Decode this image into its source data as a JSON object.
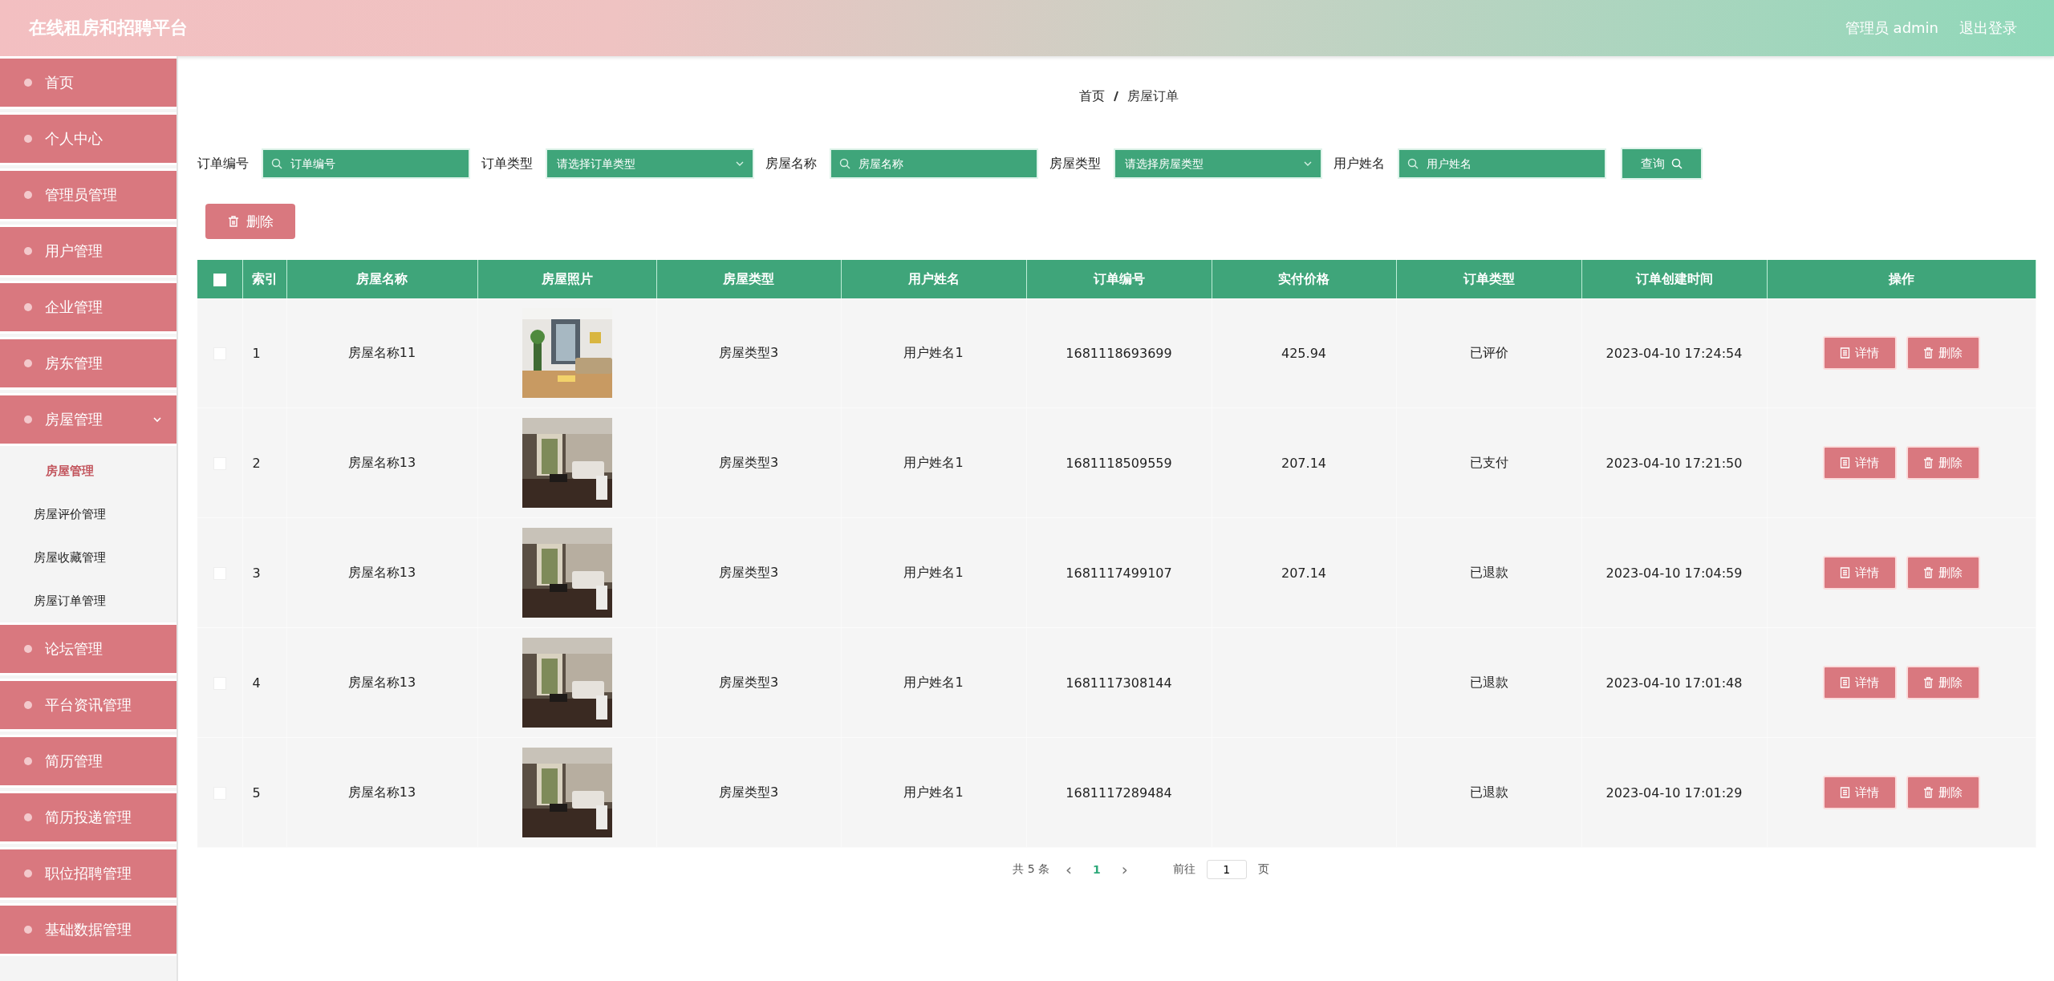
{
  "header": {
    "title": "在线租房和招聘平台",
    "user": "管理员 admin",
    "logout": "退出登录"
  },
  "sidebar": {
    "items": [
      {
        "label": "首页"
      },
      {
        "label": "个人中心"
      },
      {
        "label": "管理员管理"
      },
      {
        "label": "用户管理"
      },
      {
        "label": "企业管理"
      },
      {
        "label": "房东管理"
      },
      {
        "label": "房屋管理",
        "expanded": true,
        "children": [
          {
            "label": "房屋管理",
            "selected": true
          },
          {
            "label": "房屋评价管理",
            "selected": false
          },
          {
            "label": "房屋收藏管理",
            "selected": false
          },
          {
            "label": "房屋订单管理",
            "selected": false
          }
        ]
      },
      {
        "label": "论坛管理"
      },
      {
        "label": "平台资讯管理"
      },
      {
        "label": "简历管理"
      },
      {
        "label": "简历投递管理"
      },
      {
        "label": "职位招聘管理"
      },
      {
        "label": "基础数据管理"
      }
    ]
  },
  "breadcrumb": [
    "首页",
    "房屋订单"
  ],
  "search": {
    "fields": [
      {
        "label": "订单编号",
        "placeholder": "订单编号",
        "kind": "input"
      },
      {
        "label": "订单类型",
        "placeholder": "请选择订单类型",
        "kind": "select"
      },
      {
        "label": "房屋名称",
        "placeholder": "房屋名称",
        "kind": "input"
      },
      {
        "label": "房屋类型",
        "placeholder": "请选择房屋类型",
        "kind": "select"
      },
      {
        "label": "用户姓名",
        "placeholder": "用户姓名",
        "kind": "input"
      }
    ],
    "button": "查询"
  },
  "delete_button": "删除",
  "table": {
    "header_checked": false,
    "columns": [
      "索引",
      "房屋名称",
      "房屋照片",
      "房屋类型",
      "用户姓名",
      "订单编号",
      "实付价格",
      "订单类型",
      "订单创建时间",
      "操作"
    ],
    "rows": [
      {
        "checked": false,
        "index": "1",
        "house": "房屋名称11",
        "type": "房屋类型3",
        "user": "用户姓名1",
        "order_no": "1681118693699",
        "price": "425.94",
        "order_type": "已评价",
        "created": "2023-04-10 17:24:54",
        "actions": [
          "详情",
          "删除"
        ]
      },
      {
        "checked": false,
        "index": "2",
        "house": "房屋名称13",
        "type": "房屋类型3",
        "user": "用户姓名1",
        "order_no": "1681118509559",
        "price": "207.14",
        "order_type": "已支付",
        "created": "2023-04-10 17:21:50",
        "actions": [
          "详情",
          "删除"
        ]
      },
      {
        "checked": false,
        "index": "3",
        "house": "房屋名称13",
        "type": "房屋类型3",
        "user": "用户姓名1",
        "order_no": "1681117499107",
        "price": "207.14",
        "order_type": "已退款",
        "created": "2023-04-10 17:04:59",
        "actions": [
          "详情",
          "删除"
        ]
      },
      {
        "checked": false,
        "index": "4",
        "house": "房屋名称13",
        "type": "房屋类型3",
        "user": "用户姓名1",
        "order_no": "1681117308144",
        "order_type": "已退款",
        "created": "2023-04-10 17:01:48",
        "actions": [
          "详情",
          "删除"
        ]
      },
      {
        "checked": false,
        "index": "5",
        "house": "房屋名称13",
        "type": "房屋类型3",
        "user": "用户姓名1",
        "order_no": "1681117289484",
        "order_type": "已退款",
        "created": "2023-04-10 17:01:29",
        "actions": [
          "详情",
          "删除"
        ]
      }
    ]
  },
  "pagination": {
    "total": "共 5 条",
    "prev": "‹",
    "pages": [
      {
        "label": "1",
        "selected": true
      }
    ],
    "next": "›",
    "goto": "前往",
    "page_input": "1",
    "page_suffix": "页"
  }
}
